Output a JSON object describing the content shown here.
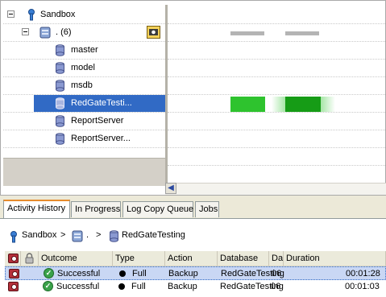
{
  "tree": {
    "root_label": "Sandbox",
    "server_label": ". (6)",
    "databases": [
      "master",
      "model",
      "msdb",
      "RedGateTesti...",
      "ReportServer",
      "ReportServer..."
    ],
    "selected_index": 3
  },
  "tabs": [
    "Activity History",
    "In Progress",
    "Log Copy Queue",
    "Jobs"
  ],
  "breadcrumb": {
    "root": "Sandbox",
    "sep1": ">",
    "server": ".",
    "sep2": ">",
    "database": "RedGateTesting"
  },
  "grid": {
    "headers": [
      "Outcome",
      "Type",
      "Action",
      "Database",
      "Dat",
      "Duration"
    ],
    "rows": [
      {
        "outcome": "Successful",
        "type": "Full",
        "action": "Backup",
        "database": "RedGateTesting",
        "date": "06",
        "duration": "00:01:28"
      },
      {
        "outcome": "Successful",
        "type": "Full",
        "action": "Backup",
        "database": "RedGateTesting",
        "date": "06",
        "duration": "00:01:03"
      }
    ]
  },
  "colors": {
    "selection": "#316ac5",
    "activity_green": "#2ec32e",
    "activity_dark_green": "#169c16",
    "server_bar": "#b4b4b4"
  }
}
